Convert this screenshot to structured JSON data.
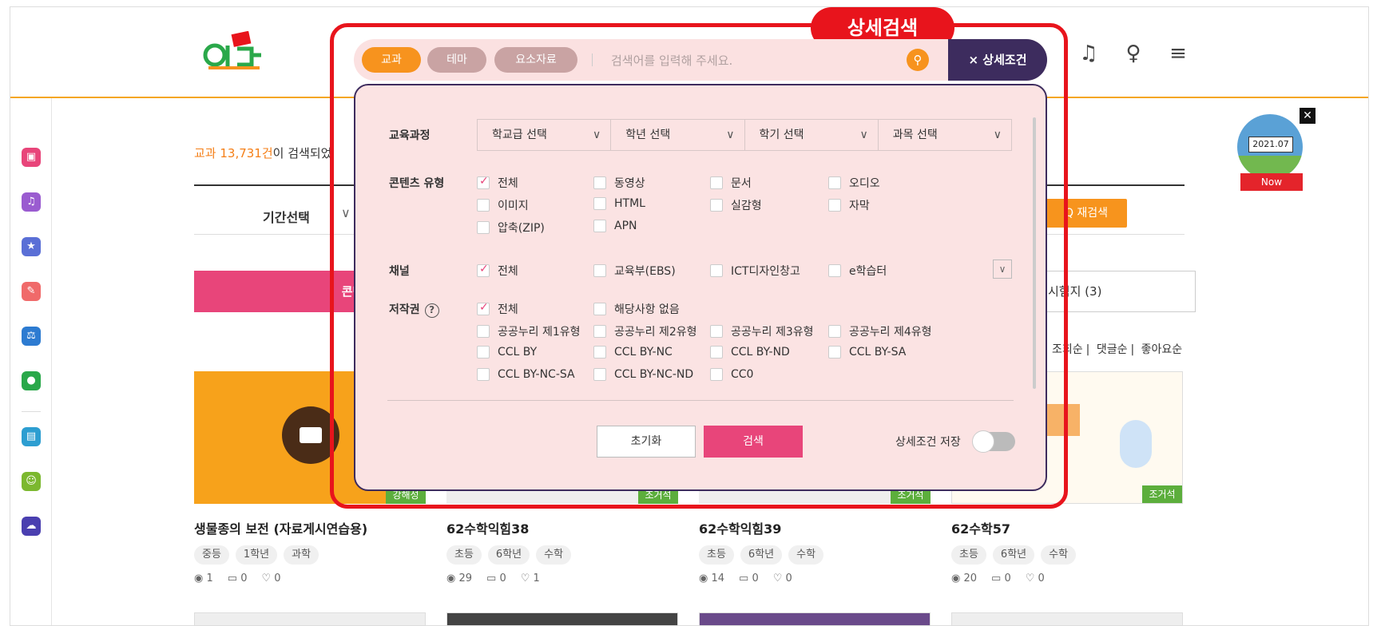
{
  "header": {
    "logo_text": "이다",
    "icons": [
      "bell-icon",
      "user-icon",
      "menu-icon"
    ]
  },
  "sidebar": {
    "icons": [
      "calendar-icon",
      "bell-icon",
      "star-icon",
      "edit-icon",
      "tools-icon",
      "chat-icon",
      "inbox-icon",
      "smile-icon",
      "cloud-upload-icon"
    ]
  },
  "results": {
    "count": "교과 13,731건",
    "suffix": "이 검색되었"
  },
  "filters": {
    "period_label": "기간선택",
    "research_label": "재검색"
  },
  "tabs": {
    "content": "콘텐츠 (13,0",
    "exam": "시험지 (3)"
  },
  "sort": [
    "조회순",
    "댓글순",
    "좋아요순"
  ],
  "cards": [
    {
      "title": "생물종의 보전 (자료게시연습용)",
      "tags": [
        "중등",
        "1학년",
        "과학"
      ],
      "views": "1",
      "comments": "0",
      "likes": "0",
      "badge": "강해성"
    },
    {
      "title": "62수학익힘38",
      "tags": [
        "초등",
        "6학년",
        "수학"
      ],
      "views": "29",
      "comments": "0",
      "likes": "1",
      "badge": "조거석"
    },
    {
      "title": "62수학익힘39",
      "tags": [
        "초등",
        "6학년",
        "수학"
      ],
      "views": "14",
      "comments": "0",
      "likes": "0",
      "badge": "조거석"
    },
    {
      "title": "62수학57",
      "tags": [
        "초등",
        "6학년",
        "수학"
      ],
      "views": "20",
      "comments": "0",
      "likes": "0",
      "badge": "조거석"
    }
  ],
  "promo": {
    "date": "2021.07",
    "now": "Now"
  },
  "highlight": {
    "label": "상세검색"
  },
  "search": {
    "pills": [
      "교과",
      "테마",
      "요소자료"
    ],
    "placeholder": "검색어를 입력해 주세요.",
    "detail_label": "× 상세조건"
  },
  "panel": {
    "curriculum": {
      "label": "교육과정",
      "selects": [
        "학교급 선택",
        "학년 선택",
        "학기 선택",
        "과목 선택"
      ]
    },
    "content_type": {
      "label": "콘텐츠 유형",
      "options": [
        "전체",
        "동영상",
        "문서",
        "오디오",
        "이미지",
        "HTML",
        "실감형",
        "자막",
        "압축(ZIP)",
        "APN"
      ]
    },
    "channel": {
      "label": "채널",
      "options": [
        "전체",
        "교육부(EBS)",
        "ICT디자인창고",
        "e학습터"
      ]
    },
    "copyright": {
      "label": "저작권",
      "options": [
        "전체",
        "해당사항 없음",
        "공공누리 제1유형",
        "공공누리 제2유형",
        "공공누리 제3유형",
        "공공누리 제4유형",
        "CCL BY",
        "CCL BY-NC",
        "CCL BY-ND",
        "CCL BY-SA",
        "CCL BY-NC-SA",
        "CCL BY-NC-ND",
        "CC0"
      ]
    },
    "reset_label": "초기화",
    "search_label": "검색",
    "save_label": "상세조건 저장"
  },
  "colors": {
    "accent": "#f7931e",
    "pink": "#e8457a",
    "dark": "#3d2c5e",
    "highlight": "#e8141c"
  }
}
